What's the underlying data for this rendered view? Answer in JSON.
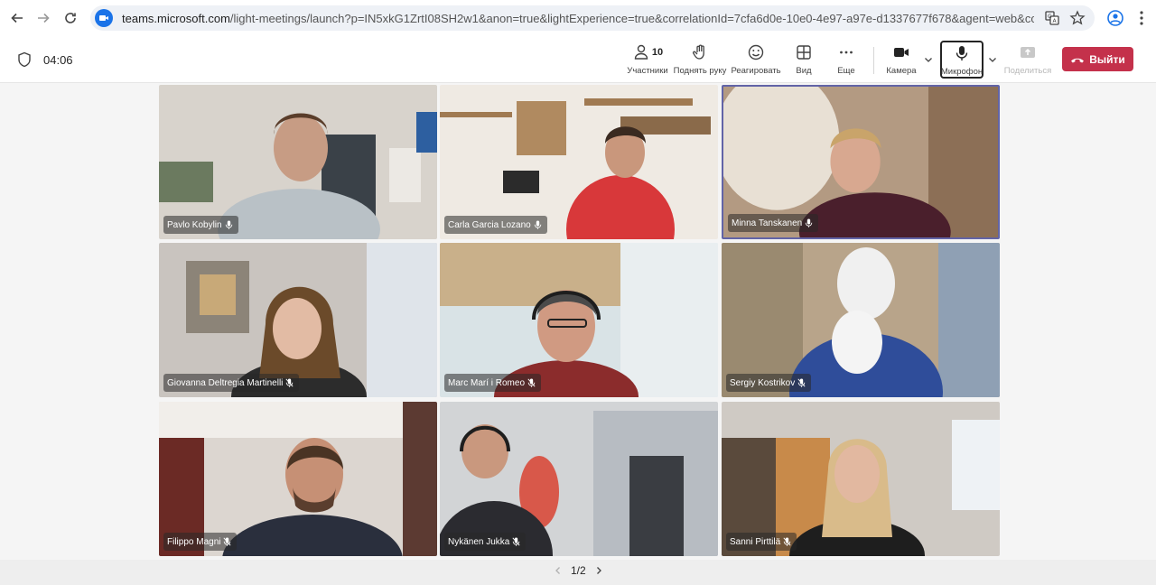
{
  "browser": {
    "url_host": "teams.microsoft.com",
    "url_rest": "/light-meetings/launch?p=IN5xkG1ZrtI08SH2w1&anon=true&lightExperience=true&correlationId=7cfa6d0e-10e0-4e97-a97e-d1337677f678&agent=web&coords=eyJtZWV0..."
  },
  "meeting": {
    "timer": "04:06"
  },
  "toolbar": {
    "participants_count": "10",
    "participants_label": "Участники",
    "raise_hand_label": "Поднять руку",
    "react_label": "Реагировать",
    "view_label": "Вид",
    "more_label": "Еще",
    "camera_label": "Камера",
    "mic_label": "Микрофон",
    "share_label": "Поделиться",
    "leave_label": "Выйти"
  },
  "participants": [
    {
      "name": "Pavlo Kobylin"
    },
    {
      "name": "Carla Garcia Lozano"
    },
    {
      "name": "Minna Tanskanen"
    },
    {
      "name": "Giovanna Deltregia Martinelli"
    },
    {
      "name": "Marc Marí i Romeo"
    },
    {
      "name": "Sergiy Kostrikov"
    },
    {
      "name": "Filippo Magni"
    },
    {
      "name": "Nykänen Jukka"
    },
    {
      "name": "Sanni Pirttilä"
    }
  ],
  "pagination": {
    "label": "1/2"
  }
}
